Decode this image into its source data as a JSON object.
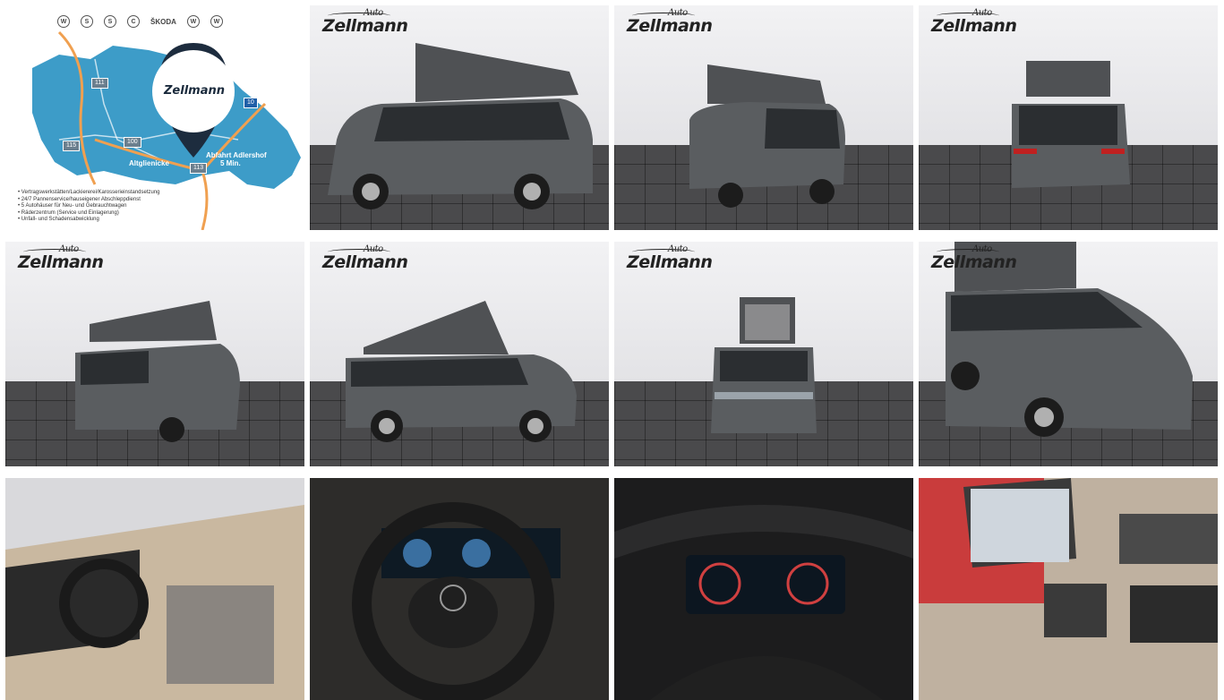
{
  "gallery": {
    "logo_main": "Zellmann",
    "logo_sub": "Auto",
    "map": {
      "brands": [
        "VW",
        "Seat",
        "SEAT",
        "CUPRA",
        "ŠKODA",
        "VW",
        "VW"
      ],
      "brand_names": {
        "skoda": "ŠKODA"
      },
      "places": [
        "Altglienicke",
        "Abfahrt Adlershof",
        "5 Min."
      ],
      "road_numbers": [
        "111",
        "115",
        "100",
        "113",
        "10"
      ],
      "bullets": [
        "• Vertragswerkstätten/Lackiererei/Karosserieinstandsetzung",
        "• 24/7 Pannenservice/hauseigener Abschleppdienst",
        "• 5 Autohäuser für Neu- und Gebrauchtwagen",
        "• Räderzentrum (Service und Einlagerung)",
        "• Unfall- und Schadensabwicklung"
      ]
    },
    "tiles": [
      {
        "id": "map"
      },
      {
        "id": "side-left"
      },
      {
        "id": "rear-three-quarter-left"
      },
      {
        "id": "rear"
      },
      {
        "id": "rear-three-quarter-right"
      },
      {
        "id": "side-right"
      },
      {
        "id": "front"
      },
      {
        "id": "front-three-quarter"
      },
      {
        "id": "interior-cockpit"
      },
      {
        "id": "interior-steering-wheel"
      },
      {
        "id": "interior-instrument-cluster"
      },
      {
        "id": "interior-door-panel"
      }
    ],
    "colors": {
      "map_blue": "#3d9cc8",
      "road_orange": "#f0a050",
      "pin_navy": "#1d2c3e",
      "car_grey": "#5a5d60",
      "floor": "#4a4a4c"
    }
  }
}
